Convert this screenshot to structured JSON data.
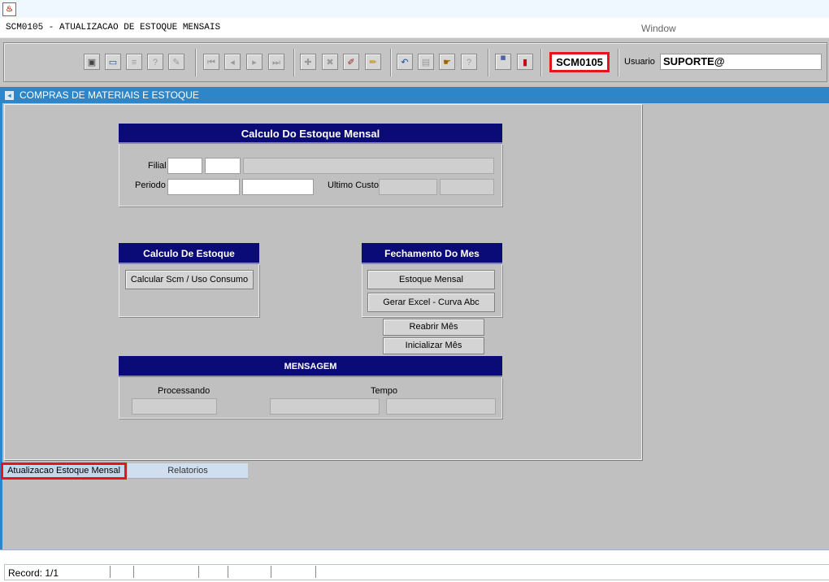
{
  "window": {
    "title": "SCM0105 - ATUALIZACAO DE ESTOQUE MENSAIS",
    "menu_window": "Window"
  },
  "toolbar": {
    "module_code": "SCM0105",
    "usuario_label": "Usuario",
    "usuario_value": "SUPORTE@",
    "icons": [
      "save-icon",
      "print-preview-icon",
      "print-icon",
      "query-icon",
      "query-execute-icon",
      "first-record-icon",
      "previous-record-icon",
      "next-record-icon",
      "last-record-icon",
      "insert-record-icon",
      "delete-record-icon",
      "edit-record-icon",
      "clear-icon",
      "undo-icon",
      "list-icon",
      "lov-icon",
      "help-icon",
      "menu-icon",
      "exit-icon"
    ]
  },
  "section": {
    "title": "COMPRAS DE MATERIAIS E ESTOQUE"
  },
  "calculo_frame": {
    "title": "Calculo Do Estoque Mensal",
    "filial_label": "Filial",
    "periodo_label": "Periodo",
    "ultimo_custo_label": "Ultimo Custo",
    "filial_code": "",
    "filial_sub": "",
    "filial_name": "",
    "periodo_start": "",
    "periodo_end": "",
    "ultimo_custo_1": "",
    "ultimo_custo_2": ""
  },
  "calculo_estoque": {
    "title": "Calculo De Estoque",
    "button": "Calcular Scm / Uso Consumo"
  },
  "fechamento": {
    "title": "Fechamento Do Mes",
    "estoque_mensal": "Estoque Mensal",
    "gerar_excel": "Gerar Excel - Curva Abc",
    "reabrir": "Reabrir Mês",
    "inicializar": "Inicializar Mês"
  },
  "mensagem": {
    "title": "MENSAGEM",
    "processando_label": "Processando",
    "tempo_label": "Tempo",
    "processando_value": "",
    "tempo_1": "",
    "tempo_2": ""
  },
  "tabs": [
    {
      "label": "Atualizacao Estoque Mensal",
      "active": true
    },
    {
      "label": "Relatorios",
      "active": false
    }
  ],
  "status": {
    "record": "Record: 1/1"
  },
  "colors": {
    "section_bar": "#2e86c8",
    "frame_header": "#0b0b78",
    "highlight": "#e8141b"
  }
}
